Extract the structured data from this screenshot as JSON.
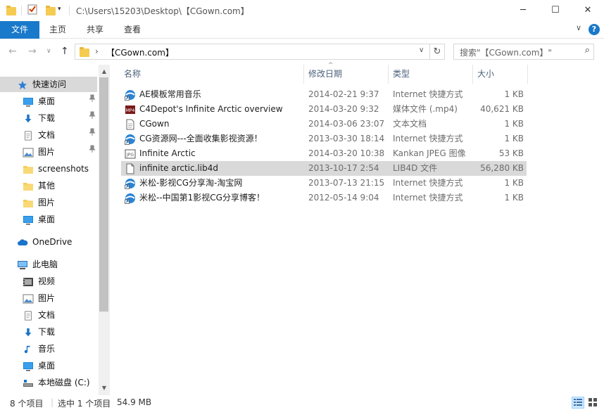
{
  "window": {
    "title_path": "C:\\Users\\15203\\Desktop\\【CGown.com】",
    "minimize": "─",
    "maximize": "☐",
    "close": "✕"
  },
  "ribbon": {
    "tabs": [
      "文件",
      "主页",
      "共享",
      "查看"
    ],
    "expand": "∨",
    "help": "?"
  },
  "nav": {
    "back": "←",
    "forward": "→",
    "recent": "∨",
    "up": "↑",
    "breadcrumb_sep": "›",
    "address": "【CGown.com】",
    "dropdown": "∨",
    "refresh": "↻",
    "search_placeholder": "搜索\"【CGown.com】\"",
    "search_icon": "⌕"
  },
  "sidebar": {
    "items": [
      {
        "label": "快速访问",
        "icon": "star-icon",
        "level": 0,
        "selected": true
      },
      {
        "label": "桌面",
        "icon": "desktop-icon",
        "level": 1,
        "pinned": true
      },
      {
        "label": "下载",
        "icon": "download-icon",
        "level": 1,
        "pinned": true
      },
      {
        "label": "文档",
        "icon": "document-icon",
        "level": 1,
        "pinned": true
      },
      {
        "label": "图片",
        "icon": "picture-icon",
        "level": 1,
        "pinned": true
      },
      {
        "label": "screenshots",
        "icon": "folder-icon",
        "level": 1
      },
      {
        "label": "其他",
        "icon": "folder-icon",
        "level": 1
      },
      {
        "label": "图片",
        "icon": "folder-icon",
        "level": 1
      },
      {
        "label": "桌面",
        "icon": "desktop-icon",
        "level": 1
      },
      {
        "label": "OneDrive",
        "icon": "cloud-icon",
        "level": 0
      },
      {
        "label": "此电脑",
        "icon": "computer-icon",
        "level": 0
      },
      {
        "label": "视频",
        "icon": "video-icon",
        "level": 1
      },
      {
        "label": "图片",
        "icon": "picture-icon",
        "level": 1
      },
      {
        "label": "文档",
        "icon": "document-icon",
        "level": 1
      },
      {
        "label": "下载",
        "icon": "download-icon",
        "level": 1
      },
      {
        "label": "音乐",
        "icon": "music-icon",
        "level": 1
      },
      {
        "label": "桌面",
        "icon": "desktop-icon",
        "level": 1
      },
      {
        "label": "本地磁盘 (C:)",
        "icon": "drive-icon",
        "level": 1
      }
    ],
    "pin_glyph": "📌"
  },
  "columns": {
    "name": "名称",
    "date": "修改日期",
    "type": "类型",
    "size": "大小",
    "sort_indicator": "^"
  },
  "files": [
    {
      "name": "AE模板常用音乐",
      "date": "2014-02-21 9:37",
      "type": "Internet 快捷方式",
      "size": "1 KB",
      "icon": "internet-shortcut-icon"
    },
    {
      "name": "C4Depot's Infinite Arctic overview",
      "date": "2014-03-20 9:32",
      "type": "媒体文件 (.mp4)",
      "size": "40,621 KB",
      "icon": "mp4-file-icon"
    },
    {
      "name": "CGown",
      "date": "2014-03-06 23:07",
      "type": "文本文档",
      "size": "1 KB",
      "icon": "text-file-icon"
    },
    {
      "name": "CG资源网---全面收集影视资源！",
      "date": "2013-03-30 18:14",
      "type": "Internet 快捷方式",
      "size": "1 KB",
      "icon": "internet-shortcut-icon"
    },
    {
      "name": "Infinite Arctic",
      "date": "2014-03-20 10:38",
      "type": "Kankan JPEG 图像",
      "size": "53 KB",
      "icon": "jpeg-file-icon"
    },
    {
      "name": "infinite arctic.lib4d",
      "date": "2013-10-17 2:54",
      "type": "LIB4D 文件",
      "size": "56,280 KB",
      "icon": "generic-file-icon",
      "selected": true
    },
    {
      "name": "米松-影视CG分享淘-淘宝网",
      "date": "2013-07-13 21:15",
      "type": "Internet 快捷方式",
      "size": "1 KB",
      "icon": "internet-shortcut-icon"
    },
    {
      "name": "米松--中国第1影视CG分享博客！",
      "date": "2012-05-14 9:04",
      "type": "Internet 快捷方式",
      "size": "1 KB",
      "icon": "internet-shortcut-icon"
    }
  ],
  "status": {
    "item_count": "8 个项目",
    "selected": "选中 1 个项目",
    "size": "54.9 MB"
  },
  "colors": {
    "accent": "#1979ca",
    "selection_grey": "#d9d9d9",
    "quick_access_highlight": "#cce8ff"
  }
}
